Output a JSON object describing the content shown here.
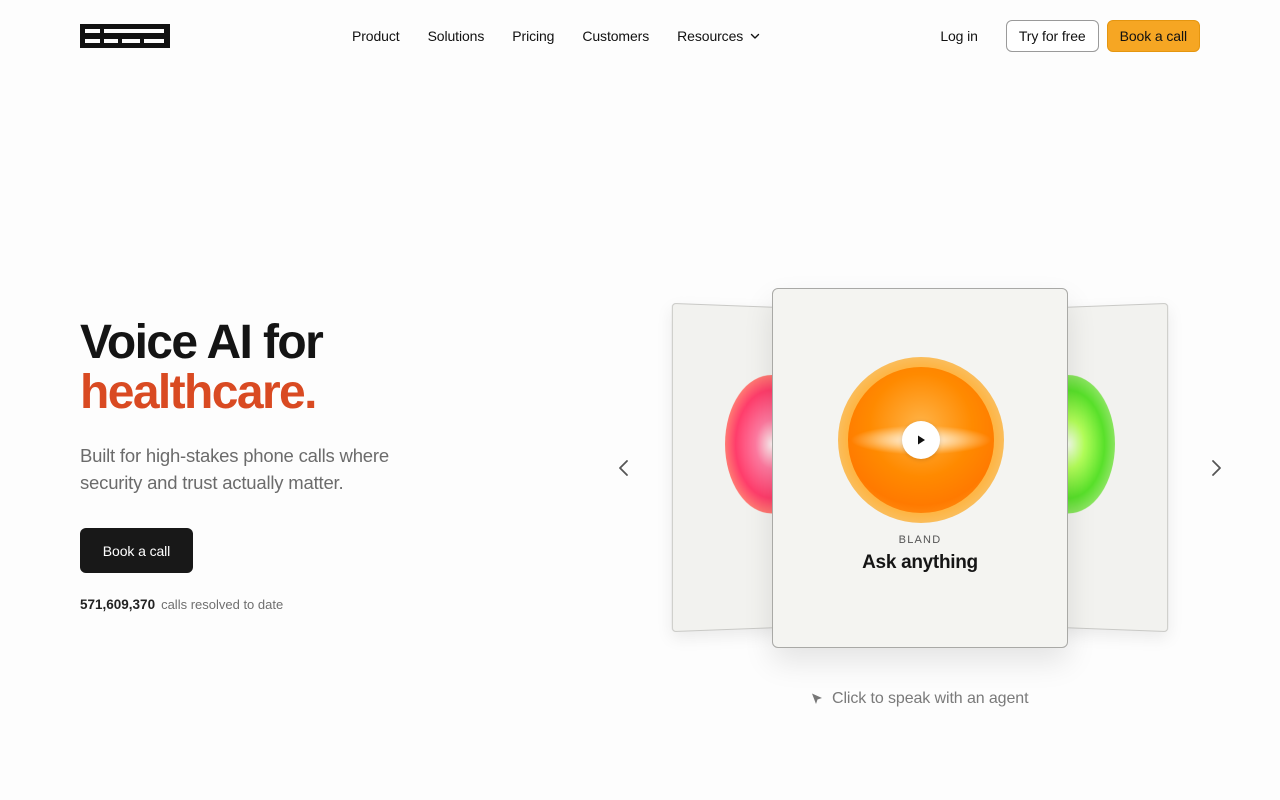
{
  "header": {
    "logo_alt": "bland",
    "nav": [
      {
        "label": "Product"
      },
      {
        "label": "Solutions"
      },
      {
        "label": "Pricing"
      },
      {
        "label": "Customers"
      },
      {
        "label": "Resources",
        "icon": "chevron-down-icon"
      }
    ],
    "login_label": "Log in",
    "try_label": "Try for free",
    "book_label": "Book a call"
  },
  "hero": {
    "headline_line1": "Voice AI for",
    "headline_accent": "healthcare.",
    "subtitle": "Built for high-stakes phone calls where security and trust actually matter.",
    "cta_label": "Book a call",
    "stat_number": "571,609,370",
    "stat_label": "calls resolved to date"
  },
  "carousel": {
    "card_brand": "BLAND",
    "card_title": "Ask anything",
    "hint": "Click to speak with an agent",
    "prev_icon": "chevron-left-icon",
    "next_icon": "chevron-right-icon"
  },
  "colors": {
    "accent": "#d94a22",
    "cta_orange": "#f6a623",
    "dark": "#181818"
  }
}
